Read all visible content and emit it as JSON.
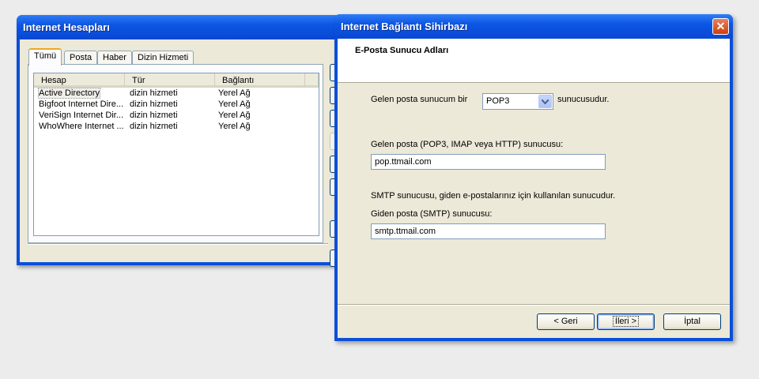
{
  "accounts_window": {
    "title": "Internet Hesapları",
    "tabs": [
      "Tümü",
      "Posta",
      "Haber",
      "Dizin Hizmeti"
    ],
    "columns": [
      "Hesap",
      "Tür",
      "Bağlantı"
    ],
    "rows": [
      {
        "account": "Active Directory",
        "type": "dizin hizmeti",
        "connection": "Yerel Ağ"
      },
      {
        "account": "Bigfoot Internet Dire...",
        "type": "dizin hizmeti",
        "connection": "Yerel Ağ"
      },
      {
        "account": "VeriSign Internet Dir...",
        "type": "dizin hizmeti",
        "connection": "Yerel Ağ"
      },
      {
        "account": "WhoWhere Internet ...",
        "type": "dizin hizmeti",
        "connection": "Yerel Ağ"
      }
    ]
  },
  "wizard": {
    "title": "Internet Bağlantı Sihirbazı",
    "close_symbol": "✕",
    "header_title": "E-Posta Sunucu Adları",
    "incoming_type_prefix": "Gelen posta sunucum bir",
    "incoming_type_value": "POP3",
    "incoming_type_suffix": "sunucusudur.",
    "incoming_server_label": "Gelen posta (POP3, IMAP veya HTTP) sunucusu:",
    "incoming_server_value": "pop.ttmail.com",
    "smtp_note": "SMTP sunucusu, giden e-postalarınız için kullanılan sunucudur.",
    "outgoing_server_label": "Giden posta (SMTP) sunucusu:",
    "outgoing_server_value": "smtp.ttmail.com",
    "buttons": {
      "back": "< Geri",
      "next": "İleri >",
      "cancel": "İptal"
    }
  },
  "colors": {
    "titlebar": "#0c56e4",
    "dialog_face": "#ece9d8",
    "close_button": "#d23c0c"
  },
  "icons": [
    "close-icon",
    "dropdown-arrow-icon"
  ]
}
